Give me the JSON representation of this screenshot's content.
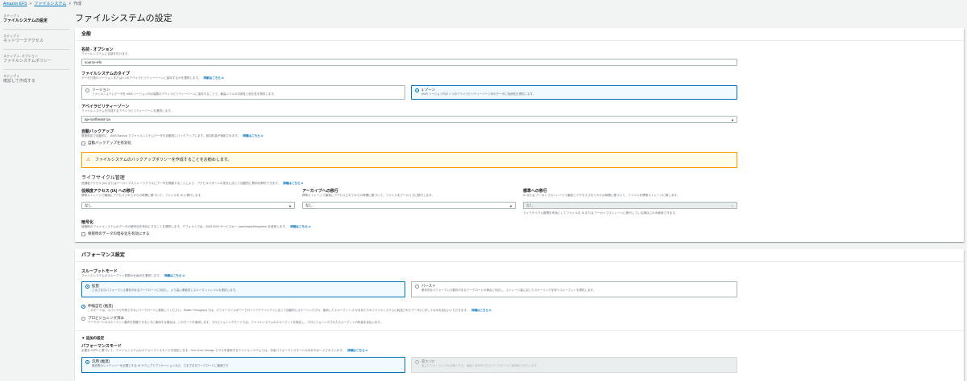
{
  "breadcrumb": {
    "service": "Amazon EFS",
    "fs": "ファイルシステム",
    "current": "作成"
  },
  "sidebar": {
    "steps": [
      {
        "num": "ステップ 1",
        "title": "ファイルシステムの設定"
      },
      {
        "num": "ステップ 2",
        "title": "ネットワークアクセス"
      },
      {
        "num": "ステップ 3 - オプション",
        "title": "ファイルシステムポリシー"
      },
      {
        "num": "ステップ 4",
        "title": "確認して作成する"
      }
    ]
  },
  "page_title": "ファイルシステムの設定",
  "general": {
    "header": "全般",
    "info_link": "詳細はこちら",
    "name": {
      "label": "名前 - オプション",
      "desc": "ファイルシステムに名前を付けます。",
      "value": "source-efs"
    },
    "fs_type": {
      "label": "ファイルシステムのタイプ",
      "desc": "データ冗長のリージョンまたは1つのアベイラビリティーゾーンに保存するかを選択します。",
      "regional": {
        "title": "リージョン",
        "desc": "ファイルシステムデータを AWS リージョン内の複数のアベイラビリティーゾーンに保存することで、最高レベルの可用性と耐久性を提供します。"
      },
      "onezone": {
        "title": "1 ゾーン",
        "desc": "AWS リージョン内の 1 つのアベイラビリティーゾーン内のデータに持続性を提供します。"
      }
    },
    "az": {
      "label": "アベイラビリティーゾーン",
      "desc": "ファイルシステムを作成するアベイラビリティーゾーンを選択します。",
      "value": "ap-northeast-1a"
    },
    "backup": {
      "label": "自動バックアップ",
      "desc": "推奨設定で自動的に、AWS Backup でファイルシステムデータを自動的にバックアップします。追加料金が適用されます。",
      "checkbox": "自動バックアップを有効化"
    },
    "warning": "ファイルシステムのバックアップポリシーを作成することをお勧めします。",
    "lifecycle": {
      "label": "ライフサイクル管理",
      "desc": "低頻度アクセス (IA) またはアーカイブストレージクラスにデータを移動することにより、アクセスパターンの変化に応じて自動的に費用を節約できます。",
      "ia": {
        "label": "低頻度アクセス (IA) への移行",
        "desc": "標準ストレージで最後にアクセスされてからの時間に基づいて、ファイルを IA に移行します。",
        "value": "なし"
      },
      "archive": {
        "label": "アーカイブへの移行",
        "desc": "標準ストレージで最後にアクセスされてからの時間に基づいて、ファイルをアーカイブに移行します。",
        "value": "なし"
      },
      "standard": {
        "label": "標準への移行",
        "desc": "IA または アーカイブストレージで最初にアクセスされてからの時間に基づいて、ファイルを標準ストレージに移します。",
        "value": "なし",
        "note": "ライフサイクル管理を有効にしてファイルを IA または アーカイブストレージに移行している場合にのみ使用できます。"
      }
    },
    "encryption": {
      "label": "暗号化",
      "desc": "保管時のファイルシステムのデータの暗号化を有効にすることを選択します。デフォルトでは、AWS KMS サービスキー (aws/elasticfilesystem) を使用します。",
      "checkbox": "保管時のデータの暗号化を有効にする"
    }
  },
  "performance": {
    "header": "パフォーマンス設定",
    "info_link": "詳細はこちら",
    "throughput": {
      "label": "スループットモード",
      "desc": "ファイルシステムのスループット制限の仕組みを選択します。",
      "enhanced": {
        "title": "拡張",
        "desc": "さまざまなパフォーマンス要件があるワークロードに対応し、より高い柔軟性とスループットレベルを提供します。"
      },
      "bursting": {
        "title": "バースト",
        "desc": "基本的なパフォーマンス要件があるワークロードの場合に対応し、ストレージ量に応じたスケーリングを伴うスループットを提供します。"
      },
      "elastic": {
        "title": "伸縮自在 (推奨)",
        "desc": "このモードは、スパイクや予測できないワークロードに推奨してください。Elastic Throughput では、パフォーマンスがワークロードアクティビティに応じて自動的にスケーリングされ、使用したスループット (1 か月あたりのファイルシステムに転送されたデータ) に対してのみお支払いいただきます。"
      },
      "provisioned": {
        "title": "プロビジョニング済み",
        "desc": "ワークロードのスループット要件を把握できるときに使用する場合は、このモードを使用します。プロビジョニングモードでは、ファイルシステムのスループットを指定し、プロビジョニングされたスループットの料金を支払います。"
      }
    },
    "additional": {
      "label": "追加の設定",
      "perf_mode_label": "パフォーマンスモード",
      "perf_mode_desc": "必要な IOPS に基づいて、ファイルシステムのパフォーマンスモードを設定します。One Zone Storage クラスを使用するファイルシステムでは、汎用パフォーマンスモードのみがサポートされています。",
      "general": {
        "title": "汎用 (推奨)",
        "desc": "最低限のレイテンシーを必要とする ID やウェブアプリケーションなど、さまざまなワークロードに最適です"
      },
      "maxio": {
        "title": "最大 I/O",
        "desc": "高いパフォーマンスを必要とする、高度に並列化されたワークロードに最適化されています"
      }
    }
  }
}
